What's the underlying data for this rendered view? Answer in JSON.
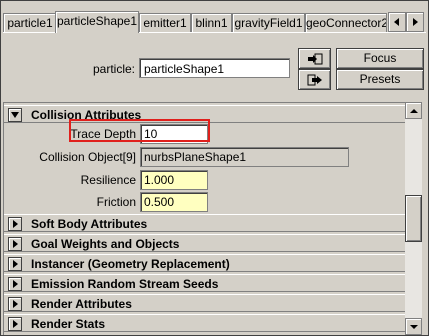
{
  "tabs": [
    {
      "label": "particle1"
    },
    {
      "label": "particleShape1"
    },
    {
      "label": "emitter1"
    },
    {
      "label": "blinn1"
    },
    {
      "label": "gravityField1"
    },
    {
      "label": "geoConnector2"
    }
  ],
  "active_tab": "particleShape1",
  "node": {
    "label": "particle:",
    "value": "particleShape1"
  },
  "buttons": {
    "focus": "Focus",
    "presets": "Presets"
  },
  "collision": {
    "title": "Collision Attributes",
    "trace_depth": {
      "label": "Trace Depth",
      "value": "10"
    },
    "collision_object": {
      "label": "Collision Object[9]",
      "value": "nurbsPlaneShape1"
    },
    "resilience": {
      "label": "Resilience",
      "value": "1.000"
    },
    "friction": {
      "label": "Friction",
      "value": "0.500"
    }
  },
  "sections": [
    {
      "title": "Soft Body Attributes"
    },
    {
      "title": "Goal Weights and Objects"
    },
    {
      "title": "Instancer (Geometry Replacement)"
    },
    {
      "title": "Emission Random Stream Seeds"
    },
    {
      "title": "Render Attributes"
    },
    {
      "title": "Render Stats"
    }
  ],
  "colors": {
    "highlight_box": "#e0201c",
    "attr_field": "#ffffc0"
  }
}
